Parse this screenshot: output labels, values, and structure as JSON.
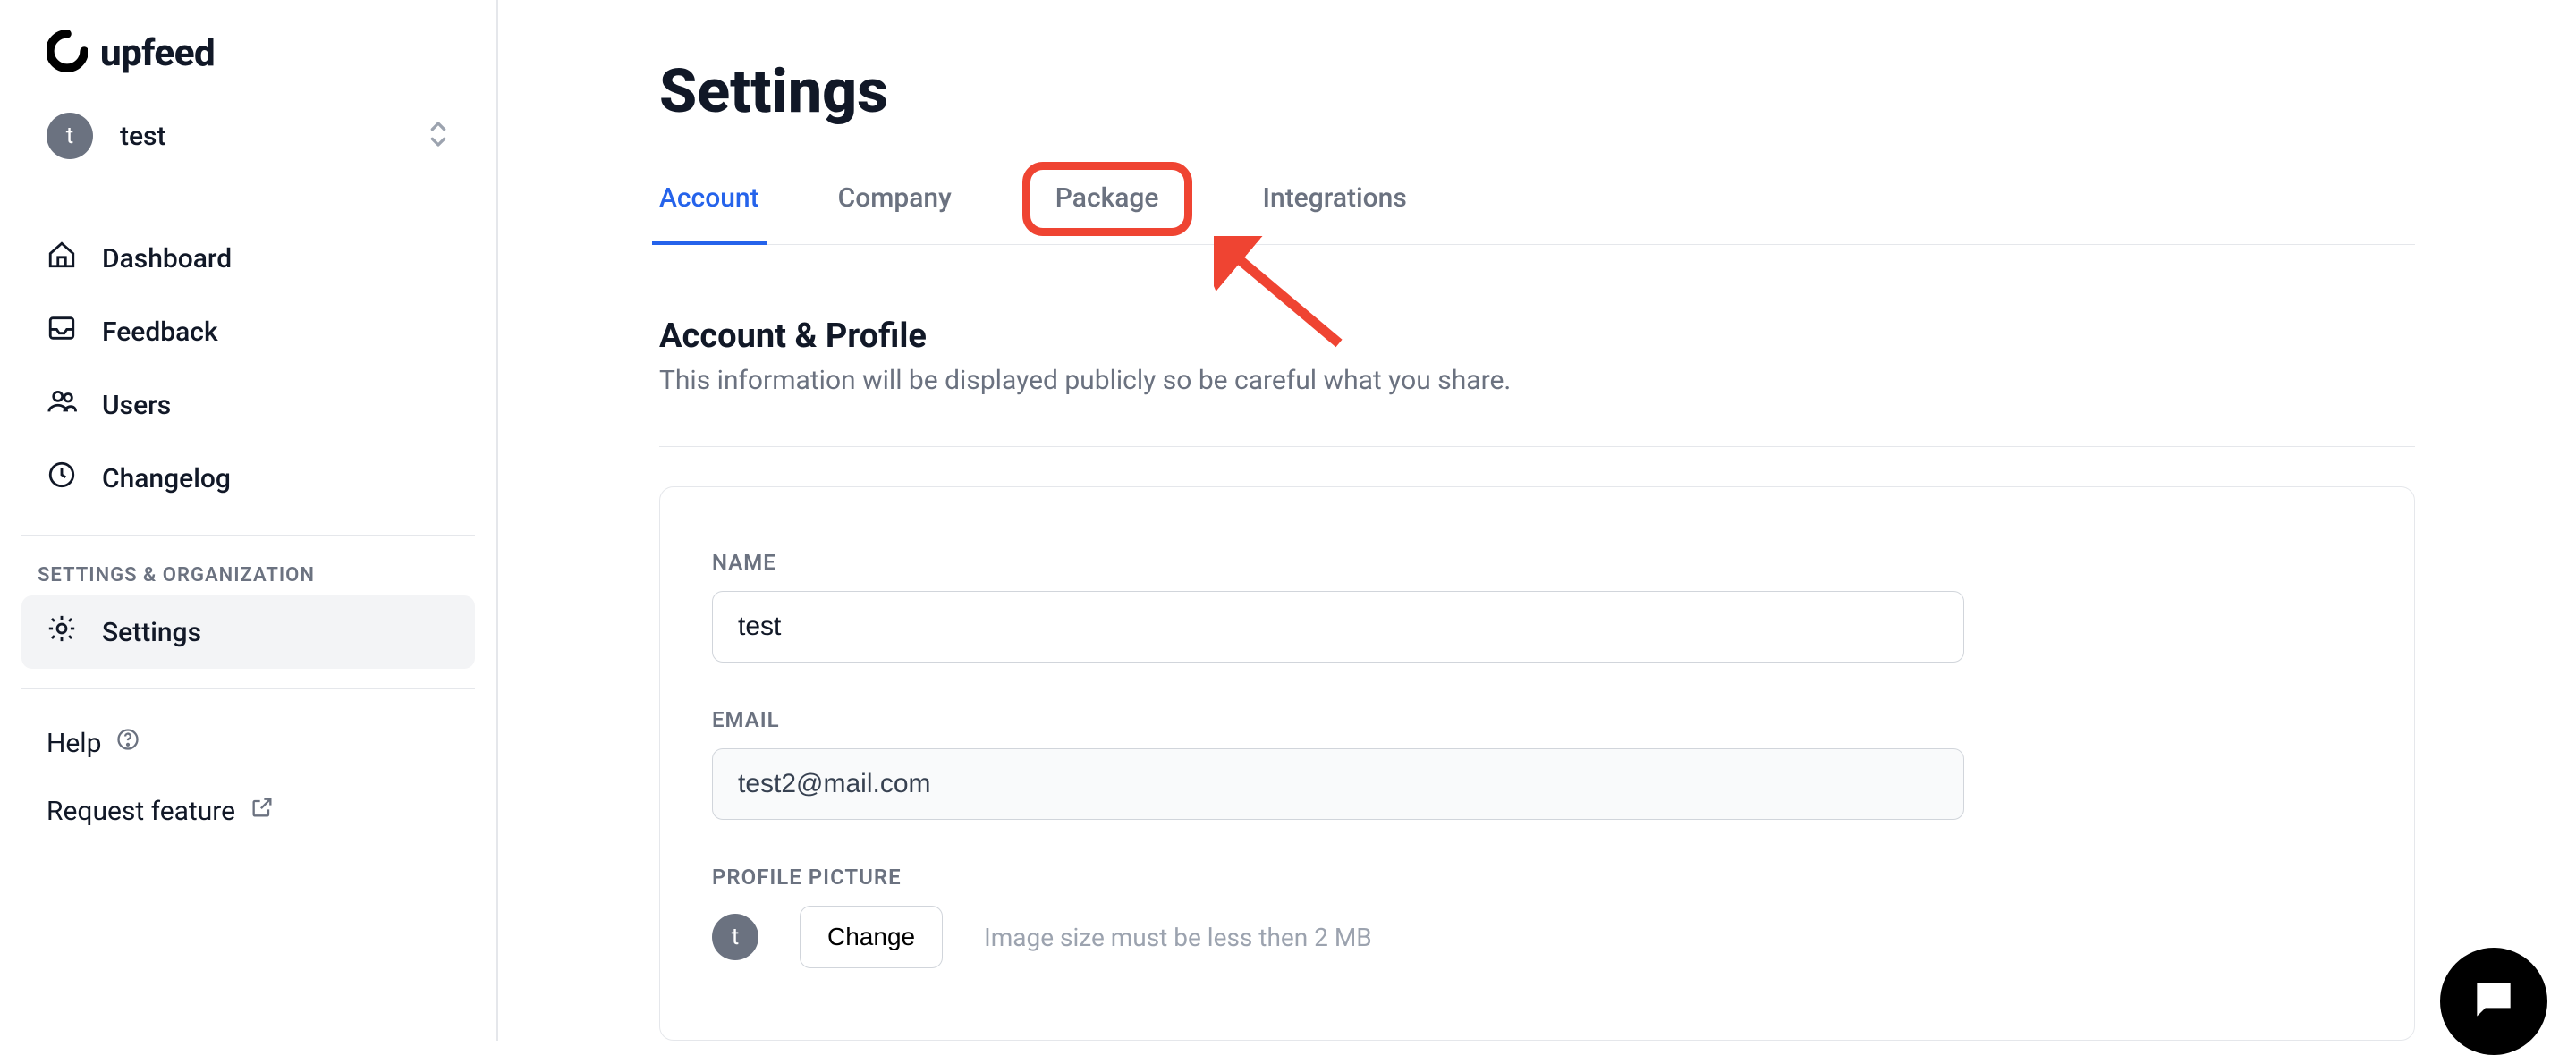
{
  "brand": {
    "name": "upfeed"
  },
  "org": {
    "avatar_letter": "t",
    "name": "test"
  },
  "sidebar": {
    "items": [
      {
        "label": "Dashboard"
      },
      {
        "label": "Feedback"
      },
      {
        "label": "Users"
      },
      {
        "label": "Changelog"
      }
    ],
    "section_label": "SETTINGS & ORGANIZATION",
    "settings_label": "Settings",
    "help_label": "Help",
    "request_feature_label": "Request feature"
  },
  "page": {
    "title": "Settings"
  },
  "tabs": [
    {
      "label": "Account",
      "active": true
    },
    {
      "label": "Company"
    },
    {
      "label": "Package",
      "highlighted": true
    },
    {
      "label": "Integrations"
    }
  ],
  "account_section": {
    "heading": "Account & Profile",
    "subtext": "This information will be displayed publicly so be careful what you share.",
    "name_label": "NAME",
    "name_value": "test",
    "email_label": "EMAIL",
    "email_value": "test2@mail.com",
    "pp_label": "PROFILE PICTURE",
    "pp_avatar_letter": "t",
    "pp_button": "Change",
    "pp_hint": "Image size must be less then 2 MB"
  },
  "annotation": {
    "type": "arrow",
    "color": "#EF4432",
    "target_tab": "Package"
  }
}
